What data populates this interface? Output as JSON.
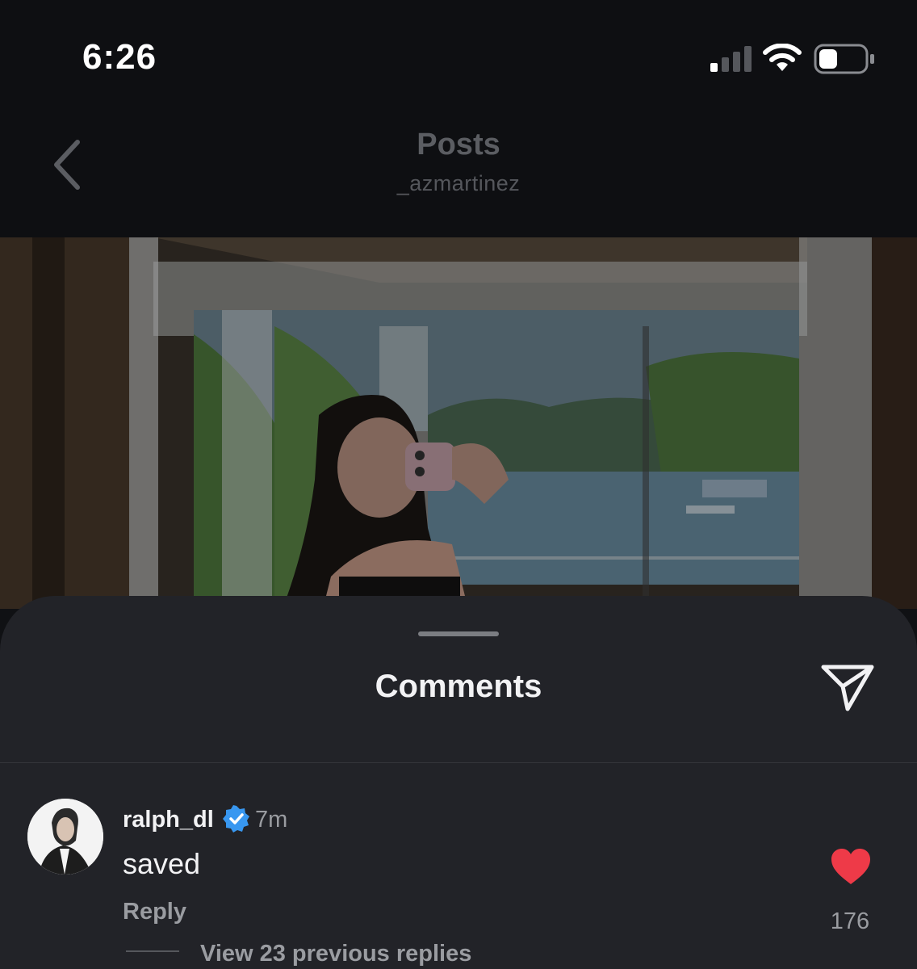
{
  "status_bar": {
    "time": "6:26",
    "icons": [
      "signal-icon",
      "wifi-icon",
      "battery-icon"
    ],
    "signal_bars_active": 1,
    "signal_bars_total": 4,
    "battery_level": 0.3
  },
  "header": {
    "title": "Posts",
    "subtitle": "_azmartinez",
    "back_icon": "chevron-left-icon"
  },
  "comments": {
    "title": "Comments",
    "share_icon": "paper-plane-icon",
    "items": [
      {
        "username": "ralph_dl",
        "verified": true,
        "time": "7m",
        "text": "saved",
        "reply_label": "Reply",
        "liked": true,
        "like_count": "176",
        "view_replies_label": "View 23 previous replies"
      }
    ]
  },
  "colors": {
    "background": "#101114",
    "sheet": "#222328",
    "text_primary": "#f2f2f4",
    "text_secondary": "#9a9ca1",
    "heart": "#ee3a48",
    "verified": "#3897f0"
  }
}
